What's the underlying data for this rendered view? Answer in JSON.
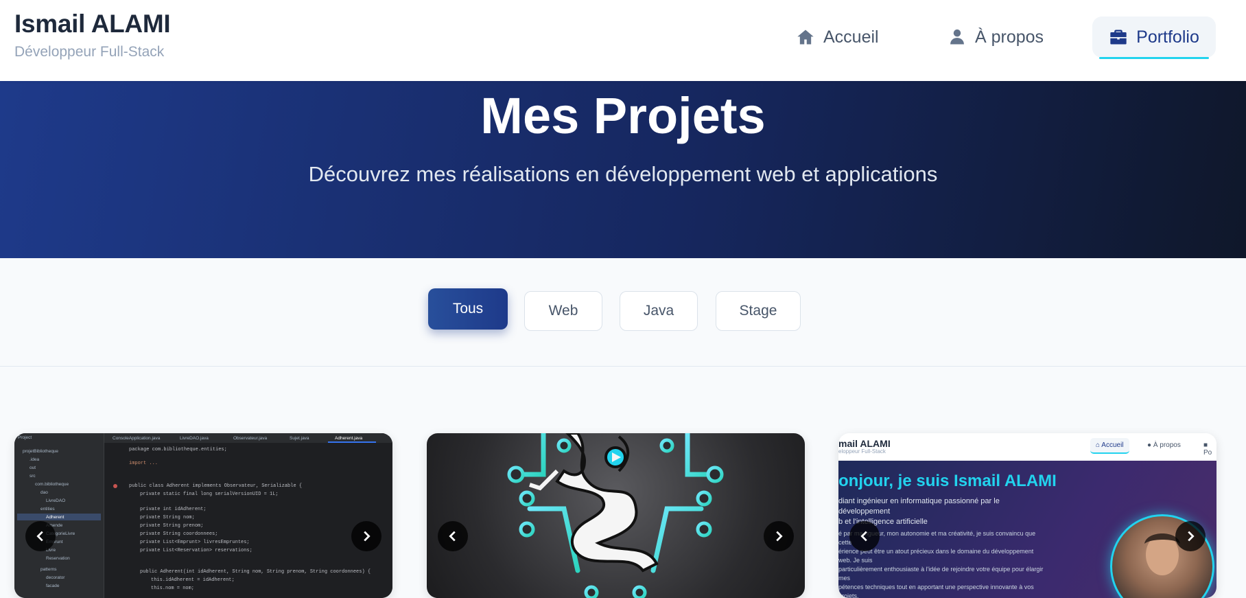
{
  "header": {
    "name": "Ismail ALAMI",
    "subtitle": "Développeur Full-Stack",
    "nav": [
      {
        "label": "Accueil",
        "icon": "home-icon"
      },
      {
        "label": "À propos",
        "icon": "user-icon"
      },
      {
        "label": "Portfolio",
        "icon": "briefcase-icon",
        "active": true
      }
    ]
  },
  "hero": {
    "title": "Mes Projets",
    "subtitle": "Découvrez mes réalisations en développement web et applications"
  },
  "filters": {
    "items": [
      {
        "label": "Tous",
        "active": true
      },
      {
        "label": "Web"
      },
      {
        "label": "Java"
      },
      {
        "label": "Stage"
      }
    ]
  },
  "cards": {
    "card1": {
      "image": "java-ide-screenshot",
      "tree": [
        "Project",
        "projetBibliotheque",
        ".idea",
        "out",
        "src",
        "com.bibliotheque",
        "dao",
        "LivreDAO",
        "entities",
        "Adherent",
        "Amende",
        "CategorieLivre",
        "Emprunt",
        "Livre",
        "Reservation",
        "patterns",
        "decorator",
        "facade"
      ],
      "tabs": [
        "ConsoleApplication.java",
        "LivreDAO.java",
        "Observateur.java",
        "Sujet.java",
        "Adherent.java"
      ],
      "code": [
        "package com.bibliotheque.entities;",
        "import ...",
        "public class Adherent implements Observateur, Serializable {",
        "private static final long serialVersionUID = 1L;",
        "private int idAdherent;",
        "private String nom;",
        "private String prenom;",
        "private String coordonnees;",
        "private List<Emprunt> livresEmpruntes;",
        "private List<Reservation> reservations;",
        "public Adherent(int idAdherent, String nom, String prenom, String coordonnees) {",
        "this.idAdherent = idAdherent;",
        "this.nom = nom;"
      ]
    },
    "card2": {
      "image": "circuit-runner-logo"
    },
    "card3": {
      "image": "portfolio-homepage-screenshot",
      "name": "mail ALAMI",
      "subtitle": "eloppeur Full-Stack",
      "nav": [
        "Accueil",
        "À propos",
        "Po"
      ],
      "heading": "onjour, je suis Ismail ALAMI",
      "lines": [
        "diant ingénieur en informatique passionné par le développement",
        "b et l'intelligence artificielle"
      ],
      "paragraph": [
        "é par ma rigueur, mon autonomie et ma créativité, je suis convaincu que cette",
        "érience peut être un atout précieux dans le domaine du développement web. Je suis",
        "particulièrement enthousiaste à l'idée de rejoindre votre équipe pour élargir mes",
        "pétences techniques tout en apportant une perspective innovante à vos projets."
      ]
    }
  },
  "colors": {
    "primary": "#1e3a8a",
    "accent": "#22d3ee",
    "text": "#1e293b",
    "muted": "#94a3b8"
  }
}
